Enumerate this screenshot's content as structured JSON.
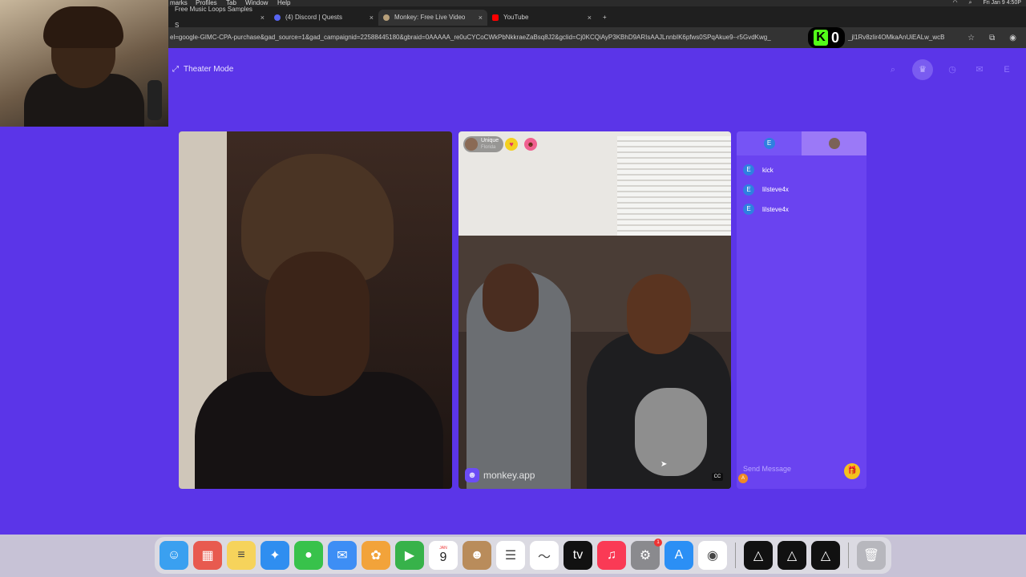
{
  "menubar": {
    "items": [
      "marks",
      "Profiles",
      "Tab",
      "Window",
      "Help"
    ],
    "datetime": "Fri Jan 9  4:50P"
  },
  "tabs": [
    {
      "label": "Free Music Loops Samples S",
      "color": "#444"
    },
    {
      "label": "(4) Discord | Quests",
      "color": "#5865f2"
    },
    {
      "label": "Monkey: Free Live Video",
      "color": "#b8a07a"
    },
    {
      "label": "YouTube",
      "color": "#ff0000"
    }
  ],
  "address": {
    "url": "el=google-GIMC-CPA-purchase&gad_source=1&gad_campaignid=22588445180&gbraid=0AAAAA_re0uCYCoCWkPbNkkraeZaBsq8J2&gclid=Cj0KCQiAyP3KBhD9ARIsAAJLnnbIK6pfws0SPqAkue9--r5GvdKwg_",
    "url_tail": "_jl1Rv8zlir4OMkaAnUiEALw_wcB"
  },
  "kick": {
    "letter": "K",
    "count": "0"
  },
  "page": {
    "theater_label": "Theater Mode"
  },
  "remote": {
    "name": "Unique",
    "location": "Florida"
  },
  "watermark": "monkey.app",
  "chat": {
    "self_initial": "E",
    "messages": [
      {
        "initial": "E",
        "text": "kick"
      },
      {
        "initial": "E",
        "text": "lilsteve4x"
      },
      {
        "initial": "E",
        "text": "lilsteve4x"
      }
    ],
    "placeholder": "Send Message",
    "mini_initial": "A"
  },
  "top_icons": [
    "search-icon",
    "crown-icon",
    "history-icon",
    "chat-icon",
    "profile-E"
  ],
  "dock": {
    "calendar_month": "JAN",
    "calendar_day": "9",
    "settings_badge": "1",
    "apps": [
      {
        "name": "finder",
        "color": "#3aa0f0",
        "glyph": "☺"
      },
      {
        "name": "launchpad",
        "color": "#e85a4f",
        "glyph": "▦"
      },
      {
        "name": "notes",
        "color": "#f6d35b",
        "glyph": "≡"
      },
      {
        "name": "safari",
        "color": "#2f8ef0",
        "glyph": "✦"
      },
      {
        "name": "messages",
        "color": "#38c24b",
        "glyph": "●"
      },
      {
        "name": "mail",
        "color": "#3d8ef5",
        "glyph": "✉"
      },
      {
        "name": "photos",
        "color": "#f2a33a",
        "glyph": "✿"
      },
      {
        "name": "facetime",
        "color": "#37b24a",
        "glyph": "▶"
      },
      {
        "name": "calendar",
        "color": "#ffffff",
        "glyph": ""
      },
      {
        "name": "contacts",
        "color": "#b98c5b",
        "glyph": "☻"
      },
      {
        "name": "reminders",
        "color": "#ffffff",
        "glyph": "☰"
      },
      {
        "name": "freeform",
        "color": "#ffffff",
        "glyph": "〜"
      },
      {
        "name": "apple-tv",
        "color": "#111111",
        "glyph": "tv"
      },
      {
        "name": "music",
        "color": "#fa3a55",
        "glyph": "♫"
      },
      {
        "name": "system-settings",
        "color": "#8a8a8e",
        "glyph": "⚙"
      },
      {
        "name": "app-store",
        "color": "#2b8ff5",
        "glyph": "A"
      },
      {
        "name": "chrome",
        "color": "#ffffff",
        "glyph": "◉"
      },
      {
        "name": "app-a",
        "color": "#111111",
        "glyph": "△"
      },
      {
        "name": "app-b",
        "color": "#111111",
        "glyph": "△"
      },
      {
        "name": "app-c",
        "color": "#111111",
        "glyph": "△"
      },
      {
        "name": "trash",
        "color": "#b7b7bd",
        "glyph": "🗑"
      }
    ]
  }
}
